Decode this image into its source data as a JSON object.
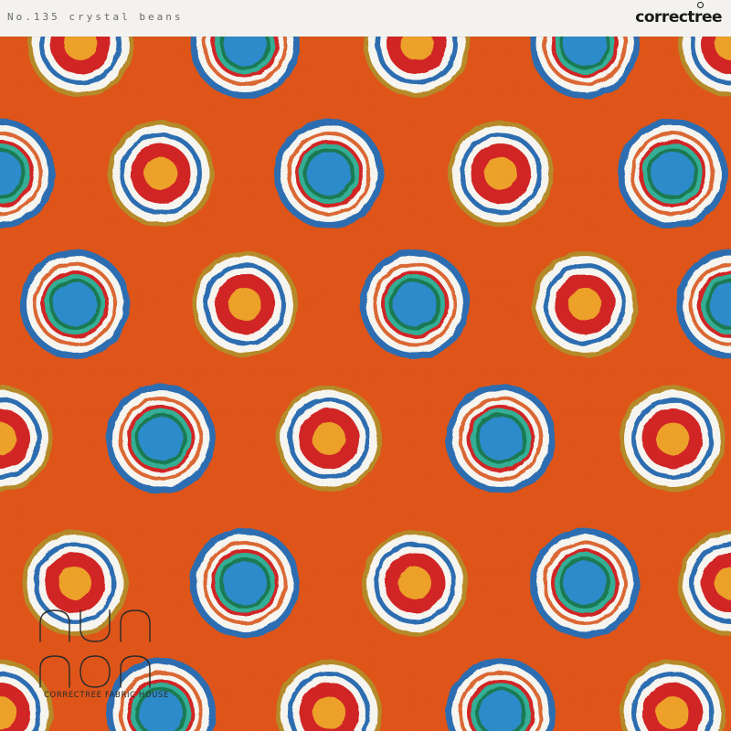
{
  "header": {
    "pattern_name": "No.135  crystal beans",
    "brand": "correctree"
  },
  "watermark": {
    "logo": "nunnon",
    "caption": "CORRECTREE FABRIC HOUSE"
  },
  "colors": {
    "background": "#e4571a",
    "header_bar": "#f3f2ee",
    "gold": "#b98e2b",
    "blue": "#2e6fb5",
    "white": "#fbfaf4",
    "red": "#d62628",
    "yellow": "#f2a52b",
    "teal": "#36b39a"
  },
  "motifs": {
    "types": [
      "gold-white-blue-red-yellow-dot",
      "blue-white-red-teal-blue-dot"
    ]
  }
}
